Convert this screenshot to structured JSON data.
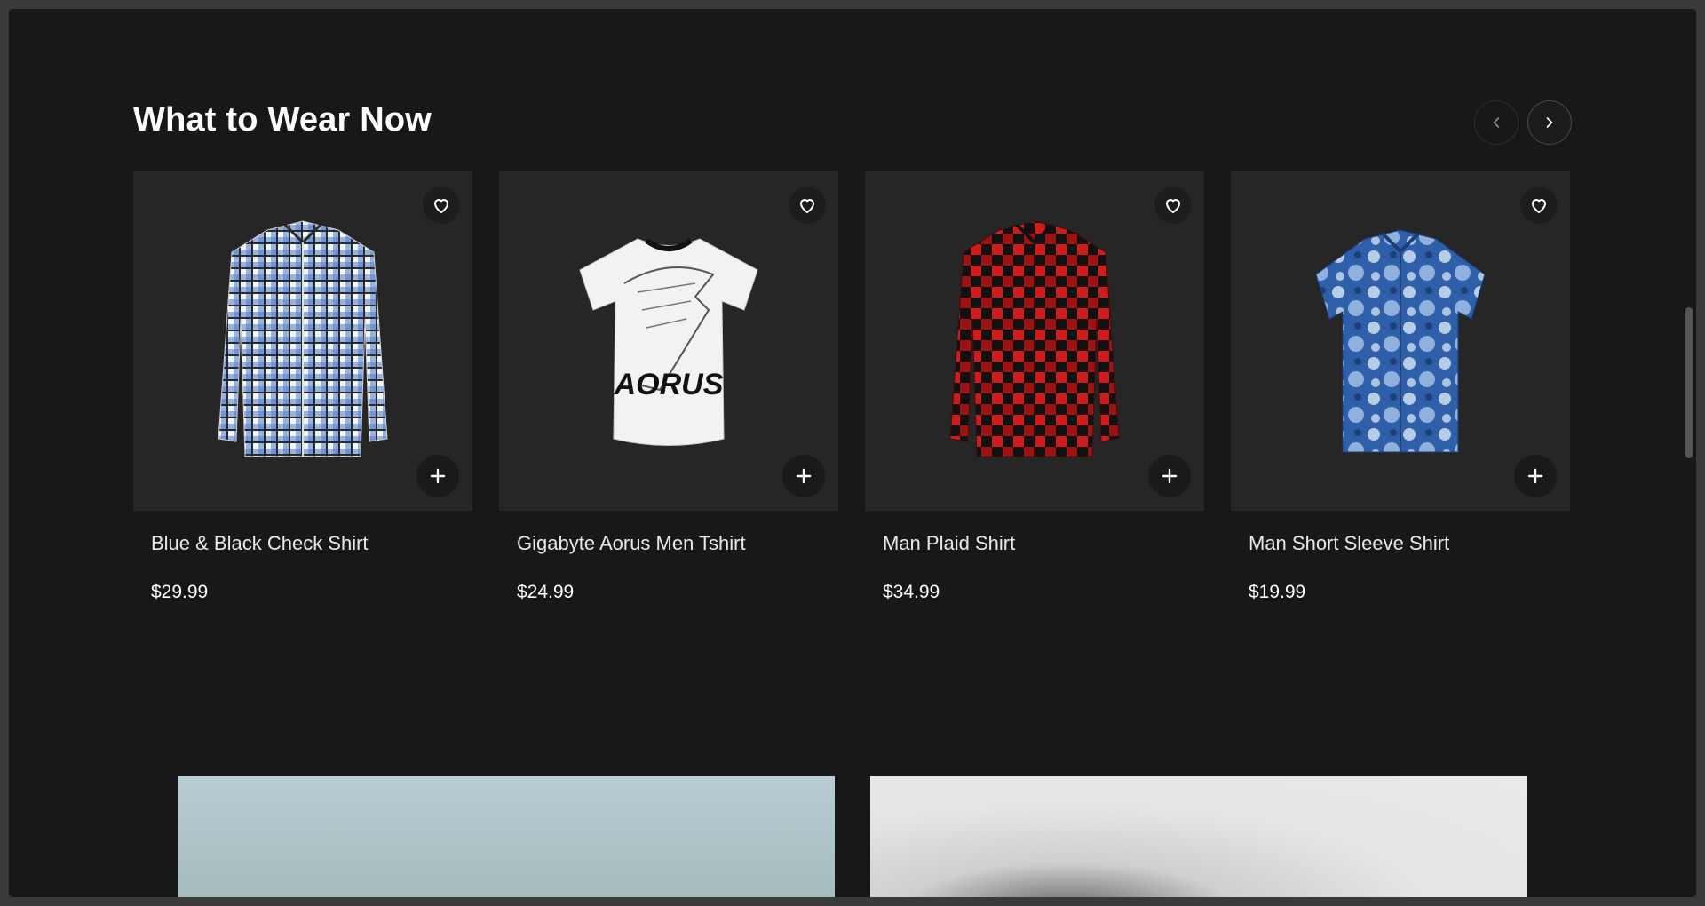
{
  "section": {
    "title": "What to Wear Now",
    "prev_icon": "chevron-left-icon",
    "next_icon": "chevron-right-icon"
  },
  "products": [
    {
      "name": "Blue & Black Check Shirt",
      "price": "$29.99",
      "pattern": "check",
      "colors": [
        "#ffffff",
        "#4a78c8",
        "#2b2b2b"
      ]
    },
    {
      "name": "Gigabyte Aorus Men Tshirt",
      "price": "$24.99",
      "pattern": "tshirt",
      "colors": [
        "#f2f2f2",
        "#111111"
      ]
    },
    {
      "name": "Man Plaid Shirt",
      "price": "$34.99",
      "pattern": "plaid",
      "colors": [
        "#d11a1a",
        "#111111"
      ]
    },
    {
      "name": "Man Short Sleeve Shirt",
      "price": "$19.99",
      "pattern": "floral",
      "colors": [
        "#2f5fa8",
        "#cfe0f4"
      ]
    }
  ],
  "card_icons": {
    "favorite": "heart-icon",
    "add": "plus-icon"
  },
  "colors": {
    "background": "#181818",
    "card": "#262626",
    "text": "#ffffff"
  }
}
